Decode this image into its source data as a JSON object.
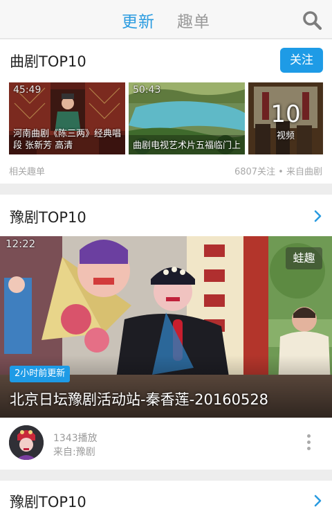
{
  "header": {
    "tabs": [
      {
        "label": "更新",
        "active": true
      },
      {
        "label": "趣单",
        "active": false
      }
    ],
    "search_icon": "search-icon"
  },
  "opera_list": {
    "title": "曲剧TOP10",
    "follow_label": "关注",
    "videos": [
      {
        "duration": "45:49",
        "title": "河南曲剧《陈三两》经典唱段 张新芳 高清"
      },
      {
        "duration": "50:43",
        "title": "曲剧电视艺术片五福临门上"
      }
    ],
    "more_card": {
      "count": "10",
      "label": "视频"
    },
    "footer_left": "相关趣单",
    "footer_right": "6807关注 • 来自曲剧"
  },
  "featured": {
    "title": "豫剧TOP10",
    "video": {
      "duration": "12:22",
      "brand": "蛙趣",
      "badge": "2小时前更新",
      "title": "北京日坛豫剧活动站-秦香莲-20160528"
    },
    "meta": {
      "plays": "1343播放",
      "source": "来自:豫剧"
    }
  },
  "next_section": {
    "title": "豫剧TOP10"
  },
  "colors": {
    "accent": "#1e9be6",
    "tab_active": "#2a9be0",
    "tab_inactive": "#9a9a9a"
  }
}
